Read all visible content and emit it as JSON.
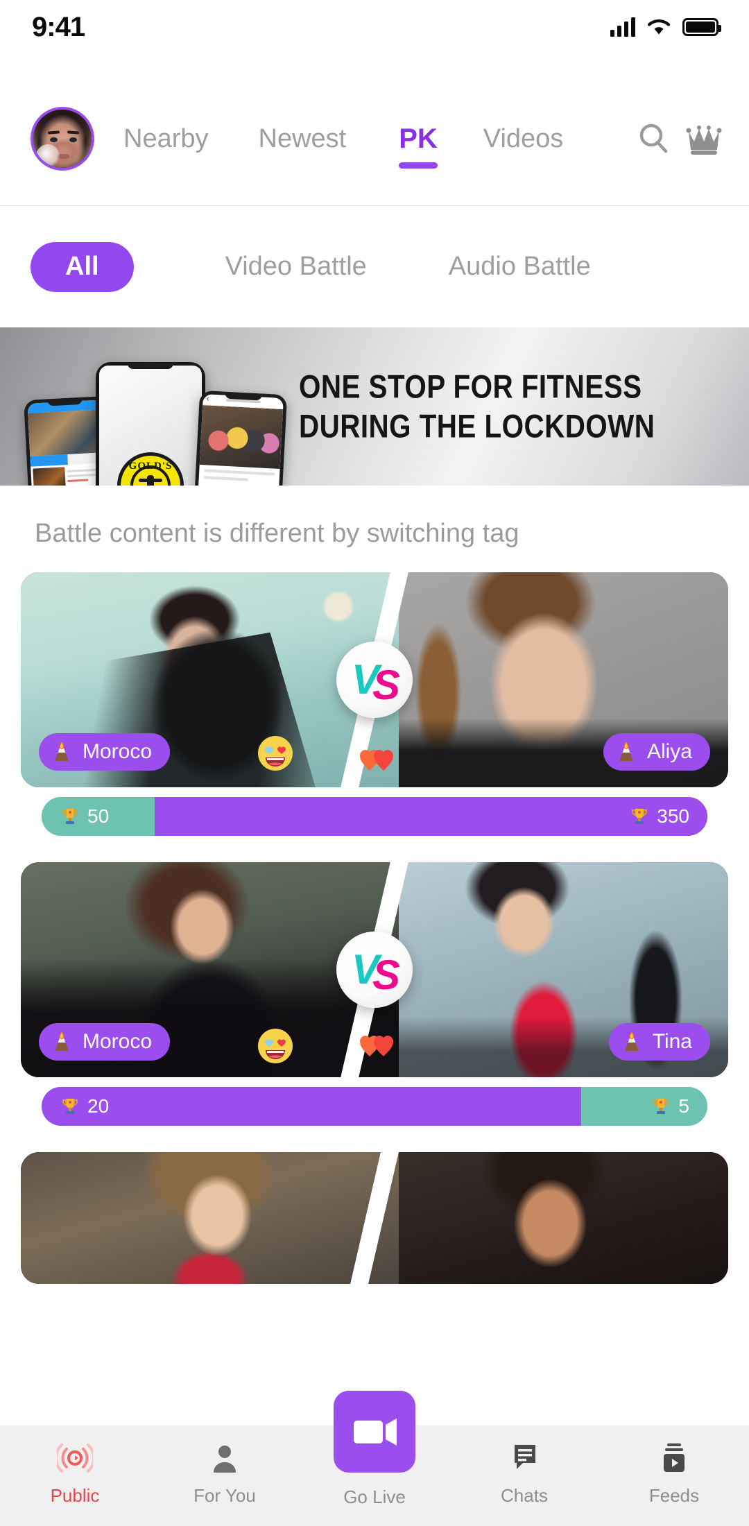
{
  "status_bar": {
    "time": "9:41",
    "signal_icon": "cellular-signal-icon",
    "wifi_icon": "wifi-icon",
    "battery_icon": "battery-full-icon"
  },
  "header": {
    "avatar_name": "user-avatar",
    "nav_items": [
      {
        "label": "Nearby",
        "active": false
      },
      {
        "label": "Newest",
        "active": false
      },
      {
        "label": "PK",
        "active": true
      },
      {
        "label": "Videos",
        "active": false
      }
    ],
    "search_icon": "search-icon",
    "crown_icon": "crown-icon"
  },
  "filters": {
    "items": [
      {
        "label": "All",
        "active": true
      },
      {
        "label": "Video Battle",
        "active": false
      },
      {
        "label": "Audio Battle",
        "active": false
      }
    ]
  },
  "banner": {
    "line1": "ONE STOP FOR FITNESS",
    "line2": "DURING THE LOCKDOWN",
    "logo_text": "GOLD'S"
  },
  "section": {
    "label": "Battle content is different by switching tag"
  },
  "colors": {
    "purple": "#9b4dee",
    "purple_dark": "#8b2fe6",
    "teal": "#6ec2b0",
    "vs_teal": "#18c9c2",
    "vs_pink": "#ec0a8f",
    "red_active": "#e8474a",
    "grey_text": "#9e9e9e"
  },
  "battles": [
    {
      "left": {
        "name": "Moroco",
        "score": "50",
        "bar_color": "teal",
        "width_pct": 17
      },
      "right": {
        "name": "Aliya",
        "score": "350",
        "bar_color": "purple",
        "width_pct": 83
      },
      "emoji_face": "heart-eyes-emoji",
      "hearts_icon": "double-hearts-icon",
      "vs_label": "VS"
    },
    {
      "left": {
        "name": "Moroco",
        "score": "20",
        "bar_color": "purple",
        "width_pct": 81
      },
      "right": {
        "name": "Tina",
        "score": "5",
        "bar_color": "teal",
        "width_pct": 19
      },
      "emoji_face": "heart-eyes-emoji",
      "hearts_icon": "double-hearts-icon",
      "vs_label": "VS"
    },
    {
      "left": {
        "name": "",
        "score": "",
        "bar_color": "teal",
        "width_pct": 50
      },
      "right": {
        "name": "",
        "score": "",
        "bar_color": "purple",
        "width_pct": 50
      },
      "emoji_face": "",
      "hearts_icon": "",
      "vs_label": ""
    }
  ],
  "bottom_nav": {
    "items": [
      {
        "label": "Public",
        "icon": "broadcast-icon",
        "active": true
      },
      {
        "label": "For You",
        "icon": "person-icon",
        "active": false
      },
      {
        "label": "Go Live",
        "icon": "video-camera-icon",
        "active": false
      },
      {
        "label": "Chats",
        "icon": "chat-bubble-icon",
        "active": false
      },
      {
        "label": "Feeds",
        "icon": "feed-play-icon",
        "active": false
      }
    ]
  }
}
